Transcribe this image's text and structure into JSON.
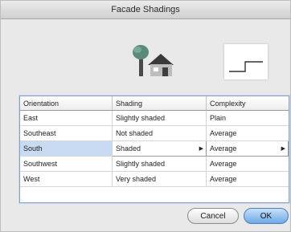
{
  "window": {
    "title": "Facade Shadings"
  },
  "illustration": {
    "main_icon": "tree-and-house-icon",
    "preview_icon": "step-profile-icon"
  },
  "table": {
    "headers": [
      "Orientation",
      "Shading",
      "Complexity"
    ],
    "rows": [
      {
        "orientation": "East",
        "shading": "Slightly shaded",
        "complexity": "Plain"
      },
      {
        "orientation": "Southeast",
        "shading": "Not shaded",
        "complexity": "Average"
      },
      {
        "orientation": "South",
        "shading": "Shaded",
        "complexity": "Average"
      },
      {
        "orientation": "Southwest",
        "shading": "Slightly shaded",
        "complexity": "Average"
      },
      {
        "orientation": "West",
        "shading": "Very shaded",
        "complexity": "Average"
      }
    ],
    "selected_row": "South"
  },
  "buttons": {
    "cancel_label": "Cancel",
    "ok_label": "OK"
  },
  "colors": {
    "selection": "#c9dbf3",
    "default_button": "#6fa9e6"
  }
}
